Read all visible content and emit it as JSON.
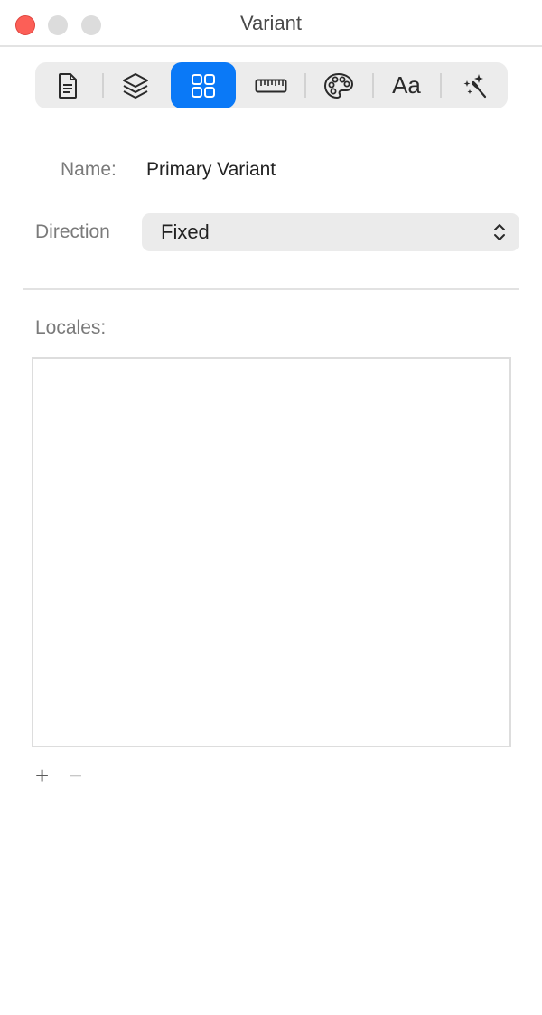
{
  "window": {
    "title": "Variant"
  },
  "toolbar": {
    "items": [
      {
        "name": "document-icon",
        "active": false
      },
      {
        "name": "layers-icon",
        "active": false
      },
      {
        "name": "grid-icon",
        "active": true
      },
      {
        "name": "ruler-icon",
        "active": false
      },
      {
        "name": "palette-icon",
        "active": false
      },
      {
        "name": "font-icon",
        "label": "Aa",
        "active": false
      },
      {
        "name": "magic-wand-icon",
        "active": false
      }
    ],
    "accent_color": "#0a79f7"
  },
  "form": {
    "name_label": "Name:",
    "name_value": "Primary Variant",
    "direction_label": "Direction",
    "direction_value": "Fixed"
  },
  "locales": {
    "label": "Locales:",
    "items": [],
    "add_label": "+",
    "remove_label": "−"
  }
}
